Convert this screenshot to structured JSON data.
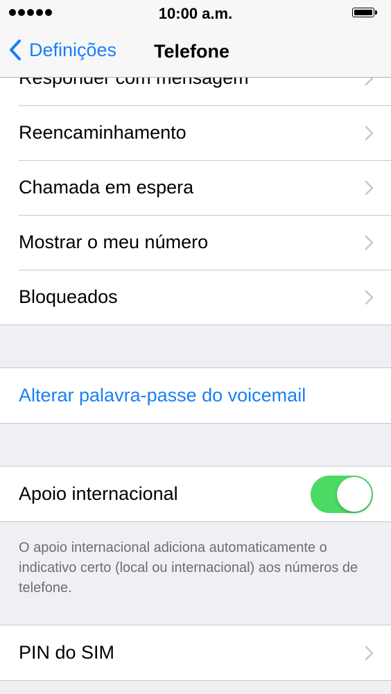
{
  "status_bar": {
    "time": "10:00 a.m."
  },
  "nav": {
    "back_label": "Definições",
    "title": "Telefone"
  },
  "groups": {
    "calls": {
      "items": [
        {
          "label": "Responder com mensagem"
        },
        {
          "label": "Reencaminhamento"
        },
        {
          "label": "Chamada em espera"
        },
        {
          "label": "Mostrar o meu número"
        },
        {
          "label": "Bloqueados"
        }
      ]
    },
    "voicemail": {
      "label": "Alterar palavra-passe do voicemail"
    },
    "international": {
      "label": "Apoio internacional",
      "enabled": true,
      "footer": "O apoio internacional adiciona automaticamente o indicativo certo (local ou internacional) aos números de telefone."
    },
    "sim": {
      "label": "PIN do SIM"
    }
  },
  "colors": {
    "accent": "#1a7ff5",
    "toggle_on": "#4cd964",
    "background": "#efeff4"
  }
}
